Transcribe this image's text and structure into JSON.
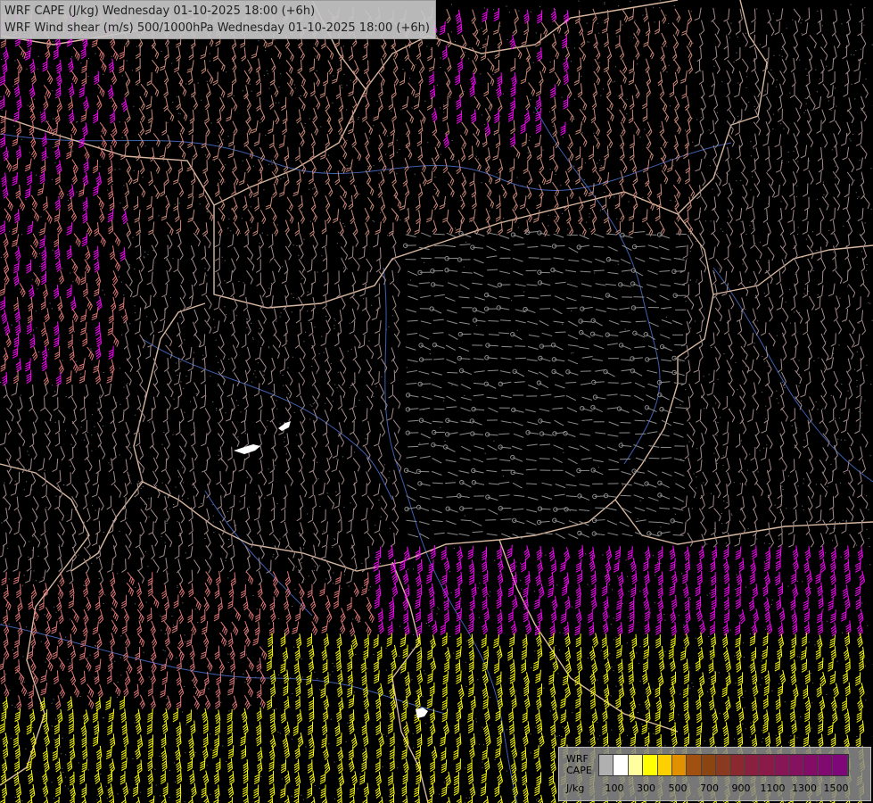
{
  "title": {
    "line1": "WRF CAPE (J/kg) Wednesday 01-10-2025 18:00 (+6h)",
    "line2": "WRF Wind shear (m/s) 500/1000hPa Wednesday 01-10-2025 18:00 (+6h)"
  },
  "legend": {
    "label_wrf": "WRF",
    "label_cape": "CAPE",
    "unit": "J/kg",
    "colors": [
      "#b0b0b0",
      "#ffffff",
      "#ffffa0",
      "#ffff00",
      "#ffd000",
      "#e09000",
      "#a05010",
      "#8b4513",
      "#8a3a20",
      "#8a2a30",
      "#8a2040",
      "#8a1a48",
      "#861656",
      "#84125e",
      "#820c66",
      "#800a70",
      "#7e0878"
    ],
    "tick_labels": [
      "100",
      "300",
      "500",
      "700",
      "900",
      "1100",
      "1300",
      "1500"
    ]
  },
  "map": {
    "shear_colors": {
      "calm": "#8c8c8c",
      "light": "#a58b8b",
      "moderate": "#c98a7a",
      "strong": "#e07878",
      "very_strong": "#ff00ff",
      "extreme": "#ffff00"
    },
    "background": "#000000",
    "border_color": "#d8b8a0",
    "river_color": "#4060b0"
  }
}
